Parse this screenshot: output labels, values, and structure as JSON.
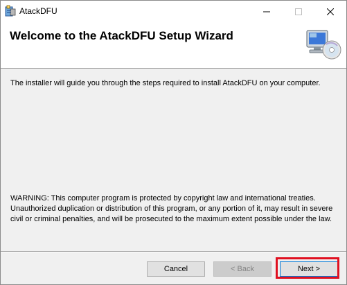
{
  "window": {
    "title": "AtackDFU",
    "controls": {
      "minimize": "—",
      "maximize": "☐",
      "close": "✕"
    }
  },
  "header": {
    "title": "Welcome to the AtackDFU Setup Wizard",
    "icon": "computer-cd-icon"
  },
  "body": {
    "intro": "The installer will guide you through the steps required to install AtackDFU on your computer.",
    "warning": "WARNING: This computer program is protected by copyright law and international treaties. Unauthorized duplication or distribution of this program, or any portion of it, may result in severe civil or criminal penalties, and will be prosecuted to the maximum extent possible under the law."
  },
  "buttons": {
    "cancel": "Cancel",
    "back": "< Back",
    "next": "Next >"
  },
  "colors": {
    "highlight": "#e01020",
    "focus_border": "#0078d7"
  }
}
